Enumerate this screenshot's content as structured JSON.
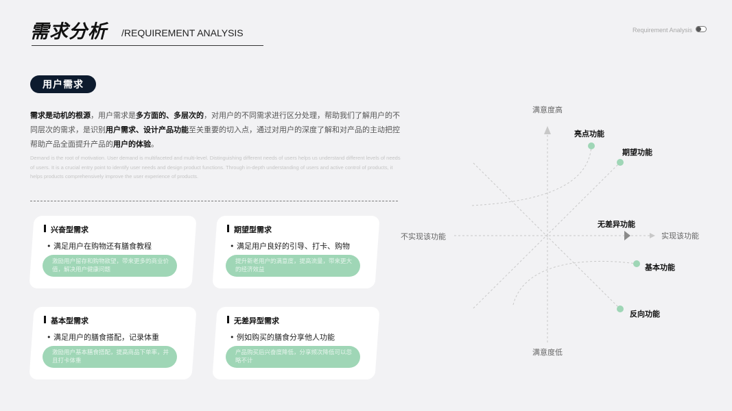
{
  "header": {
    "title": "需求分析",
    "subtitle": "/REQUIREMENT ANALYSIS",
    "corner_label": "Requirement Analysis"
  },
  "section": {
    "label": "用户需求"
  },
  "intro": {
    "cn_parts": [
      {
        "text": "需求是动机的根源",
        "bold": true
      },
      {
        "text": "，用户需求是",
        "bold": false
      },
      {
        "text": "多方面的、多层次的",
        "bold": true
      },
      {
        "text": "，对用户的不同需求进行区分处理，帮助我们了解用户的不同层次的需求，是识别",
        "bold": false
      },
      {
        "text": "用户需求、设计产品功能",
        "bold": true
      },
      {
        "text": "至关重要的切入点，通过对用户的深度了解和对产品的主动把控帮助产品全面提升产品的",
        "bold": false
      },
      {
        "text": "用户的体验",
        "bold": true
      },
      {
        "text": "。",
        "bold": false
      }
    ],
    "en": "Demand is the root of motivation. User demand is multifaceted and multi-level. Distinguishing different needs of users helps us understand different levels of needs of users. It is a crucial entry point to identify user needs and design product functions. Through in-depth understanding of users and active control of products, it helps products comprehensively improve the user experience of products."
  },
  "cards": [
    {
      "title": "兴奋型需求",
      "bullet": "• 满足用户在购物还有膳食教程",
      "note": "激励用户留存和购物欲望，带来更多的商业价值，解决用户健康问题"
    },
    {
      "title": "期望型需求",
      "bullet": "• 满足用户良好的引导、打卡、购物",
      "note": "提升新老用户的满意度，提高流量，带来更大的经济效益"
    },
    {
      "title": "基本型需求",
      "bullet": "• 满足用户的膳食搭配，记录体重",
      "note": "激励用户基本膳食搭配，提高商品下单率，并且打卡体重"
    },
    {
      "title": "无差异型需求",
      "bullet": "• 例如购买的膳食分享他人功能",
      "note": "产品购买后兴奋度降低，分享频次降低可以忽略不计"
    }
  ],
  "diagram": {
    "axis_top": "满意度高",
    "axis_bottom": "满意度低",
    "axis_left": "不实现该功能",
    "axis_right": "实现该功能",
    "features": [
      {
        "label": "亮点功能"
      },
      {
        "label": "期望功能"
      },
      {
        "label": "无差异功能"
      },
      {
        "label": "基本功能"
      },
      {
        "label": "反向功能"
      }
    ],
    "colors": {
      "dot": "#9fd6b6",
      "line": "#c8c8c8",
      "arrow": "#8a8a8a"
    }
  }
}
